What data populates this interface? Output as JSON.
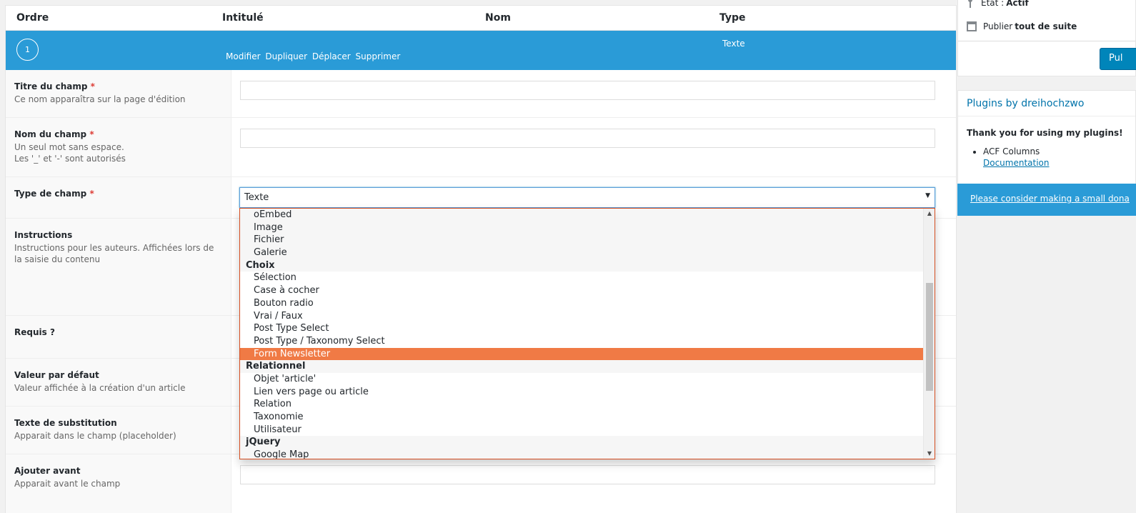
{
  "table": {
    "headers": {
      "ordre": "Ordre",
      "intitule": "Intitulé",
      "nom": "Nom",
      "type": "Type"
    }
  },
  "field_row": {
    "order": "1",
    "type": "Texte",
    "actions": [
      "Modifier",
      "Dupliquer",
      "Déplacer",
      "Supprimer"
    ]
  },
  "form": {
    "titre": {
      "label": "Titre du champ",
      "required": "*",
      "desc": "Ce nom apparaîtra sur la page d'édition"
    },
    "nom": {
      "label": "Nom du champ",
      "required": "*",
      "desc1": "Un seul mot sans espace.",
      "desc2": "Les '_' et '-' sont autorisés"
    },
    "type": {
      "label": "Type de champ",
      "required": "*",
      "selected": "Texte"
    },
    "instructions": {
      "label": "Instructions",
      "desc": "Instructions pour les auteurs. Affichées lors de la saisie du contenu"
    },
    "requis": {
      "label": "Requis ?"
    },
    "valeur": {
      "label": "Valeur par défaut",
      "desc": "Valeur affichée à la création d'un article"
    },
    "substitution": {
      "label": "Texte de substitution",
      "desc": "Apparait dans le champ (placeholder)"
    },
    "avant": {
      "label": "Ajouter avant",
      "desc": "Apparait avant le champ"
    }
  },
  "dropdown": {
    "items": [
      {
        "label": "oEmbed",
        "kind": "option"
      },
      {
        "label": "Image",
        "kind": "option"
      },
      {
        "label": "Fichier",
        "kind": "option"
      },
      {
        "label": "Galerie",
        "kind": "option"
      },
      {
        "label": "Choix",
        "kind": "group"
      },
      {
        "label": "Sélection",
        "kind": "option"
      },
      {
        "label": "Case à cocher",
        "kind": "option"
      },
      {
        "label": "Bouton radio",
        "kind": "option"
      },
      {
        "label": "Vrai / Faux",
        "kind": "option"
      },
      {
        "label": "Post Type Select",
        "kind": "option"
      },
      {
        "label": "Post Type / Taxonomy Select",
        "kind": "option"
      },
      {
        "label": "Form Newsletter",
        "kind": "selected"
      },
      {
        "label": "Relationnel",
        "kind": "group"
      },
      {
        "label": "Objet 'article'",
        "kind": "option"
      },
      {
        "label": "Lien vers page ou article",
        "kind": "option"
      },
      {
        "label": "Relation",
        "kind": "option"
      },
      {
        "label": "Taxonomie",
        "kind": "option"
      },
      {
        "label": "Utilisateur",
        "kind": "option"
      },
      {
        "label": "jQuery",
        "kind": "group"
      },
      {
        "label": "Google Map",
        "kind": "option"
      }
    ]
  },
  "publish": {
    "etat_label": "Etat :",
    "etat_value": "Actif",
    "publier_label": "Publier",
    "publier_value": "tout de suite",
    "button": "Pul"
  },
  "plugins_box": {
    "title": "Plugins by dreihochzwo",
    "thanks": "Thank you for using my plugins!",
    "plugin_name": "ACF Columns",
    "doc_link": "Documentation",
    "donate": "Please consider making a small dona"
  },
  "colors": {
    "accent": "#2a9bd7",
    "selected": "#f07a45",
    "link": "#0073aa",
    "required": "#dd3d36"
  }
}
